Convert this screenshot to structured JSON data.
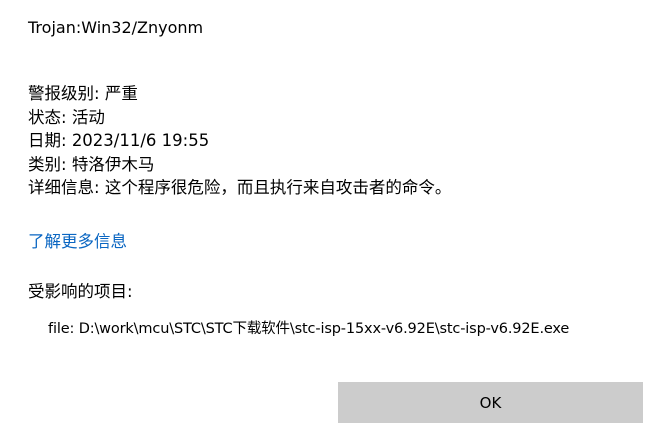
{
  "threat": {
    "name": "Trojan:Win32/Znyonm"
  },
  "details": [
    {
      "label": "警报级别",
      "value": "严重"
    },
    {
      "label": "状态",
      "value": "活动"
    },
    {
      "label": "日期",
      "value": "2023/11/6 19:55"
    },
    {
      "label": "类别",
      "value": "特洛伊木马"
    },
    {
      "label": "详细信息",
      "value": "这个程序很危险，而且执行来自攻击者的命令。"
    }
  ],
  "learn_more": {
    "label": "了解更多信息",
    "color": "#0a66c2"
  },
  "affected": {
    "heading": "受影响的项目:",
    "items": [
      {
        "prefix": "file:",
        "path": "D:\\work\\mcu\\STC\\STC下载软件\\stc-isp-15xx-v6.92E\\stc-isp-v6.92E.exe"
      }
    ]
  },
  "actions": {
    "ok_label": "OK",
    "ok_background": "#cccccc"
  }
}
